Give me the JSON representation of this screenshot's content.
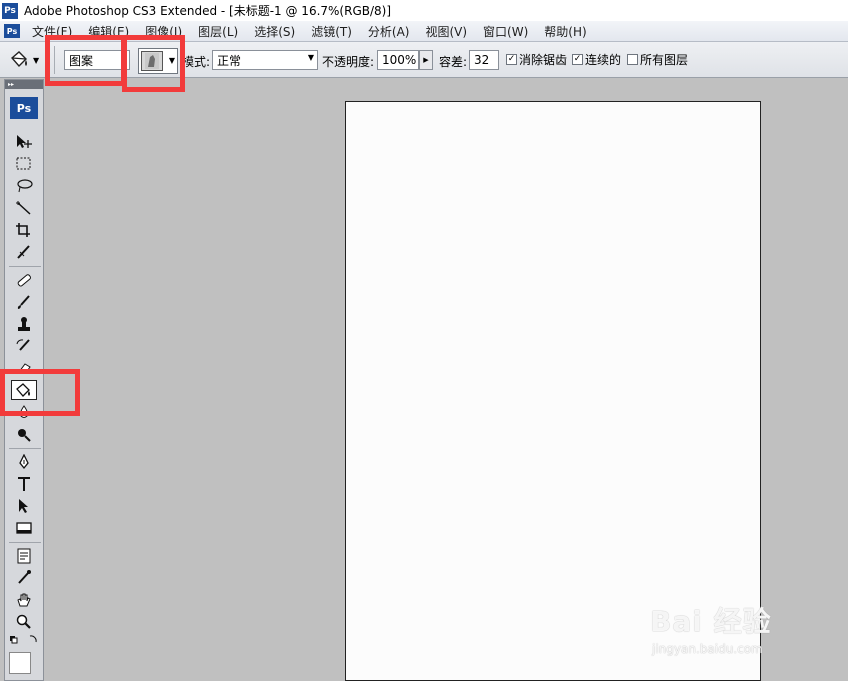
{
  "window": {
    "title": "Adobe Photoshop CS3 Extended - [未标题-1 @ 16.7%(RGB/8)]",
    "app_icon": "Ps"
  },
  "menu": [
    "文件(F)",
    "编辑(E)",
    "图像(I)",
    "图层(L)",
    "选择(S)",
    "滤镜(T)",
    "分析(A)",
    "视图(V)",
    "窗口(W)",
    "帮助(H)"
  ],
  "options": {
    "fill_source": "图案",
    "mode_label": "模式:",
    "mode_value": "正常",
    "opacity_label": "不透明度:",
    "opacity_value": "100%",
    "tolerance_label": "容差:",
    "tolerance_value": "32",
    "antialias_label": "消除锯齿",
    "antialias_checked": true,
    "contiguous_label": "连续的",
    "contiguous_checked": true,
    "all_layers_label": "所有图层",
    "all_layers_checked": false
  },
  "toolbox": {
    "logo": "Ps",
    "active_tool": "paint-bucket"
  },
  "highlight_color": "#f23b3b",
  "watermark": {
    "main": "Bai 经验",
    "sub": "jingyan.baidu.com"
  }
}
